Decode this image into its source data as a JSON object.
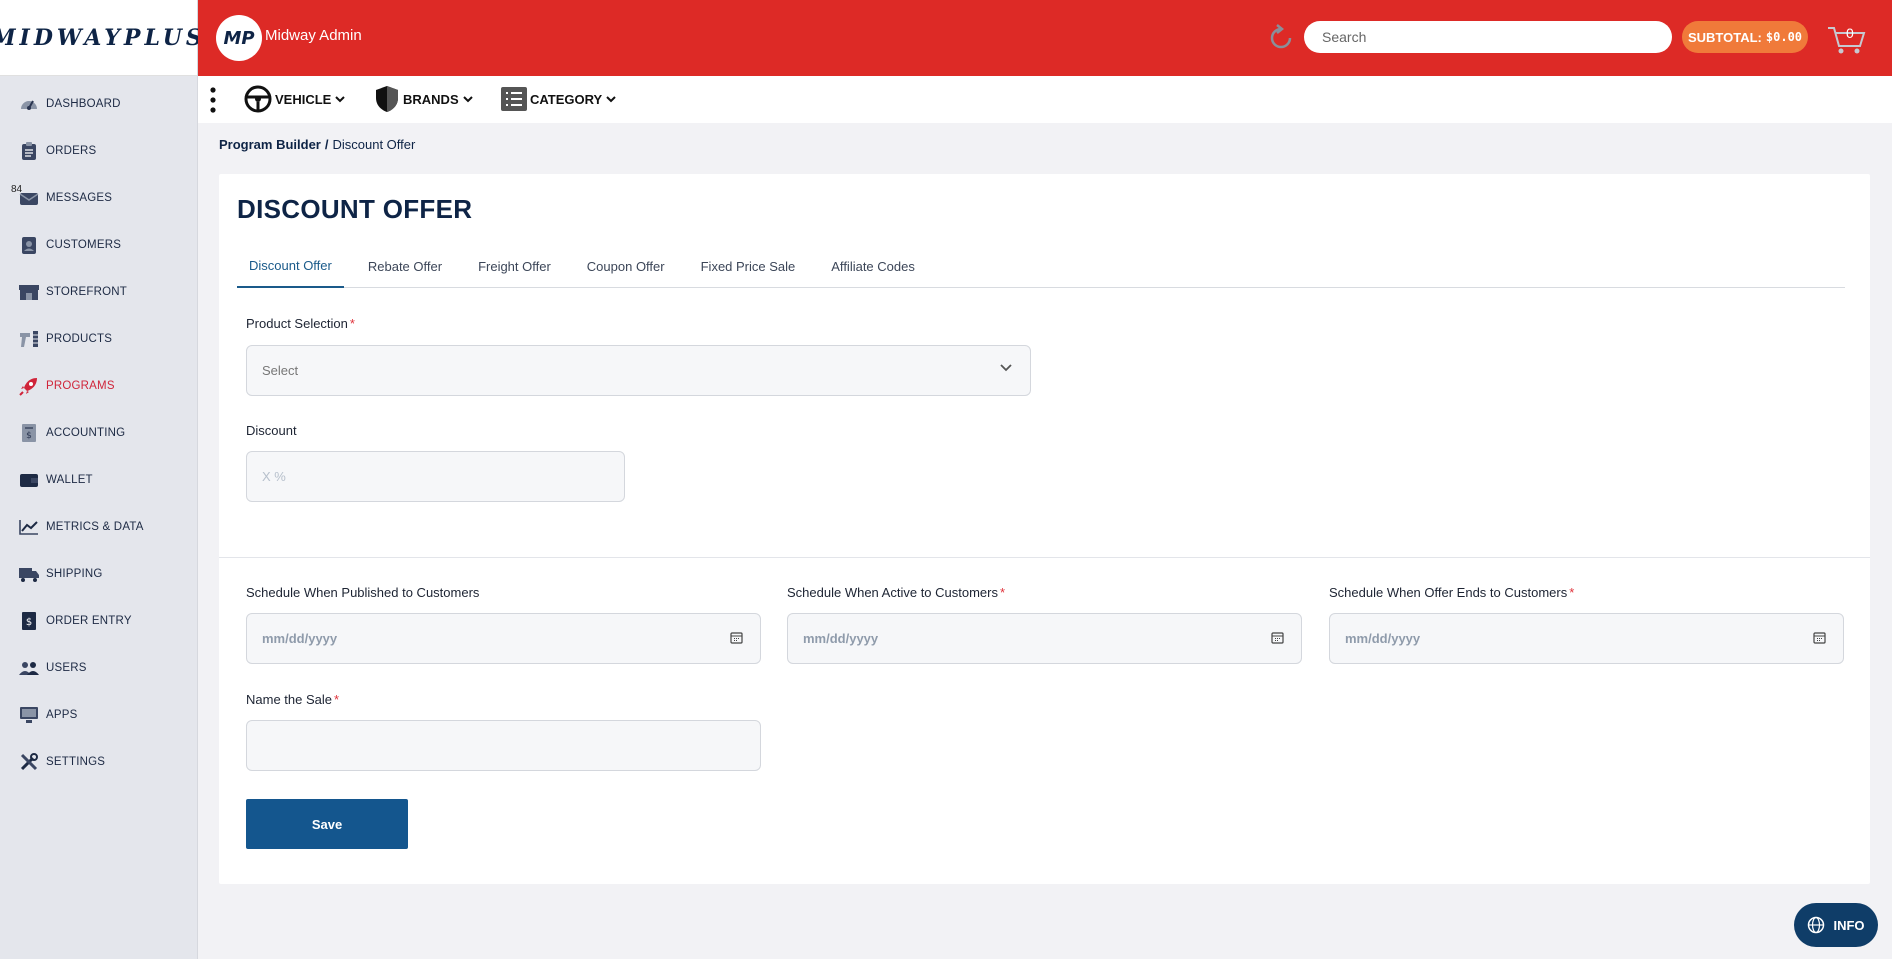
{
  "brand": {
    "logo_main": "MIDWAY",
    "logo_plus": "PLUS"
  },
  "sidebar": {
    "items": [
      {
        "label": "DASHBOARD",
        "icon": "dashboard-gauge-icon"
      },
      {
        "label": "ORDERS",
        "icon": "clipboard-icon"
      },
      {
        "label": "MESSAGES",
        "icon": "envelope-icon",
        "badge": "84"
      },
      {
        "label": "CUSTOMERS",
        "icon": "id-badge-icon"
      },
      {
        "label": "STOREFRONT",
        "icon": "storefront-icon"
      },
      {
        "label": "PRODUCTS",
        "icon": "tools-icon"
      },
      {
        "label": "PROGRAMS",
        "icon": "rocket-icon",
        "active": true
      },
      {
        "label": "ACCOUNTING",
        "icon": "invoice-icon"
      },
      {
        "label": "WALLET",
        "icon": "wallet-icon"
      },
      {
        "label": "METRICS & DATA",
        "icon": "line-chart-icon"
      },
      {
        "label": "SHIPPING",
        "icon": "truck-icon"
      },
      {
        "label": "ORDER ENTRY",
        "icon": "dollar-doc-icon"
      },
      {
        "label": "USERS",
        "icon": "users-icon"
      },
      {
        "label": "APPS",
        "icon": "monitor-icon"
      },
      {
        "label": "SETTINGS",
        "icon": "wrench-icon"
      }
    ]
  },
  "header": {
    "avatar_initials": "MP",
    "admin_name": "Midway Admin",
    "search_placeholder": "Search",
    "subtotal_label": "SUBTOTAL:",
    "subtotal_value": "$0.00",
    "cart_count": "0",
    "accent_color": "#dd2a26"
  },
  "filters": {
    "vehicle": "VEHICLE",
    "brands": "BRANDS",
    "category": "CATEGORY"
  },
  "breadcrumb": {
    "parent": "Program Builder",
    "separator": "/",
    "current": "Discount Offer"
  },
  "page": {
    "title": "DISCOUNT OFFER",
    "tabs": [
      "Discount Offer",
      "Rebate Offer",
      "Freight Offer",
      "Coupon Offer",
      "Fixed Price Sale",
      "Affiliate Codes"
    ],
    "active_tab": "Discount Offer"
  },
  "form": {
    "product_selection_label": "Product Selection",
    "product_selection_value": "Select",
    "discount_label": "Discount",
    "discount_placeholder": "X %",
    "published_label": "Schedule When Published to Customers",
    "active_label": "Schedule When Active to Customers",
    "ends_label": "Schedule When Offer Ends to Customers",
    "date_placeholder": "mm/dd/yyyy",
    "name_label": "Name the Sale",
    "required_mark": "*",
    "save_label": "Save"
  },
  "info_button": {
    "label": "INFO",
    "icon": "globe-icon"
  }
}
